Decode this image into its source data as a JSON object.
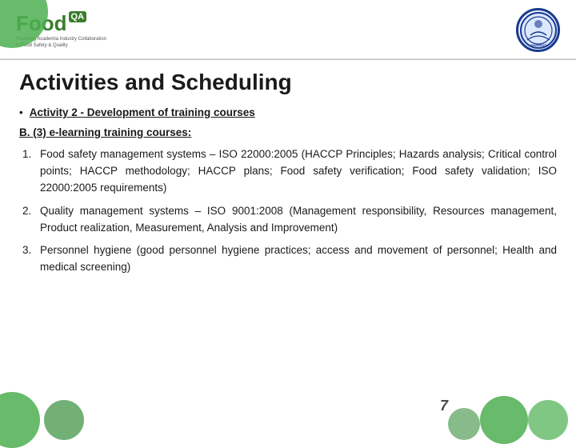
{
  "slide": {
    "title": "Activities and Scheduling",
    "header": {
      "logo_food_text": "Food",
      "logo_qa_text": "QA",
      "logo_tagline_line1": "Fostering Academia Industry Collaboration",
      "logo_tagline_line2": "in Food Safety & Quality"
    },
    "bullet": {
      "prefix": "•",
      "activity_label": "Activity 2 - Development of training courses"
    },
    "section_b": {
      "label": "B. (3) e-learning training courses:"
    },
    "numbered_items": [
      {
        "num": "1.",
        "text": "Food safety management systems – ISO 22000:2005 (HACCP Principles; Hazards analysis; Critical control points; HACCP methodology; HACCP plans; Food safety verification; Food safety validation; ISO 22000:2005 requirements)"
      },
      {
        "num": "2.",
        "text": "Quality management systems – ISO 9001:2008 (Management responsibility, Resources management, Product realization, Measurement, Analysis and Improvement)"
      },
      {
        "num": "3.",
        "text": "Personnel hygiene (good personnel hygiene practices; access and movement of personnel; Health and medical screening)"
      }
    ],
    "page_number": "7"
  }
}
